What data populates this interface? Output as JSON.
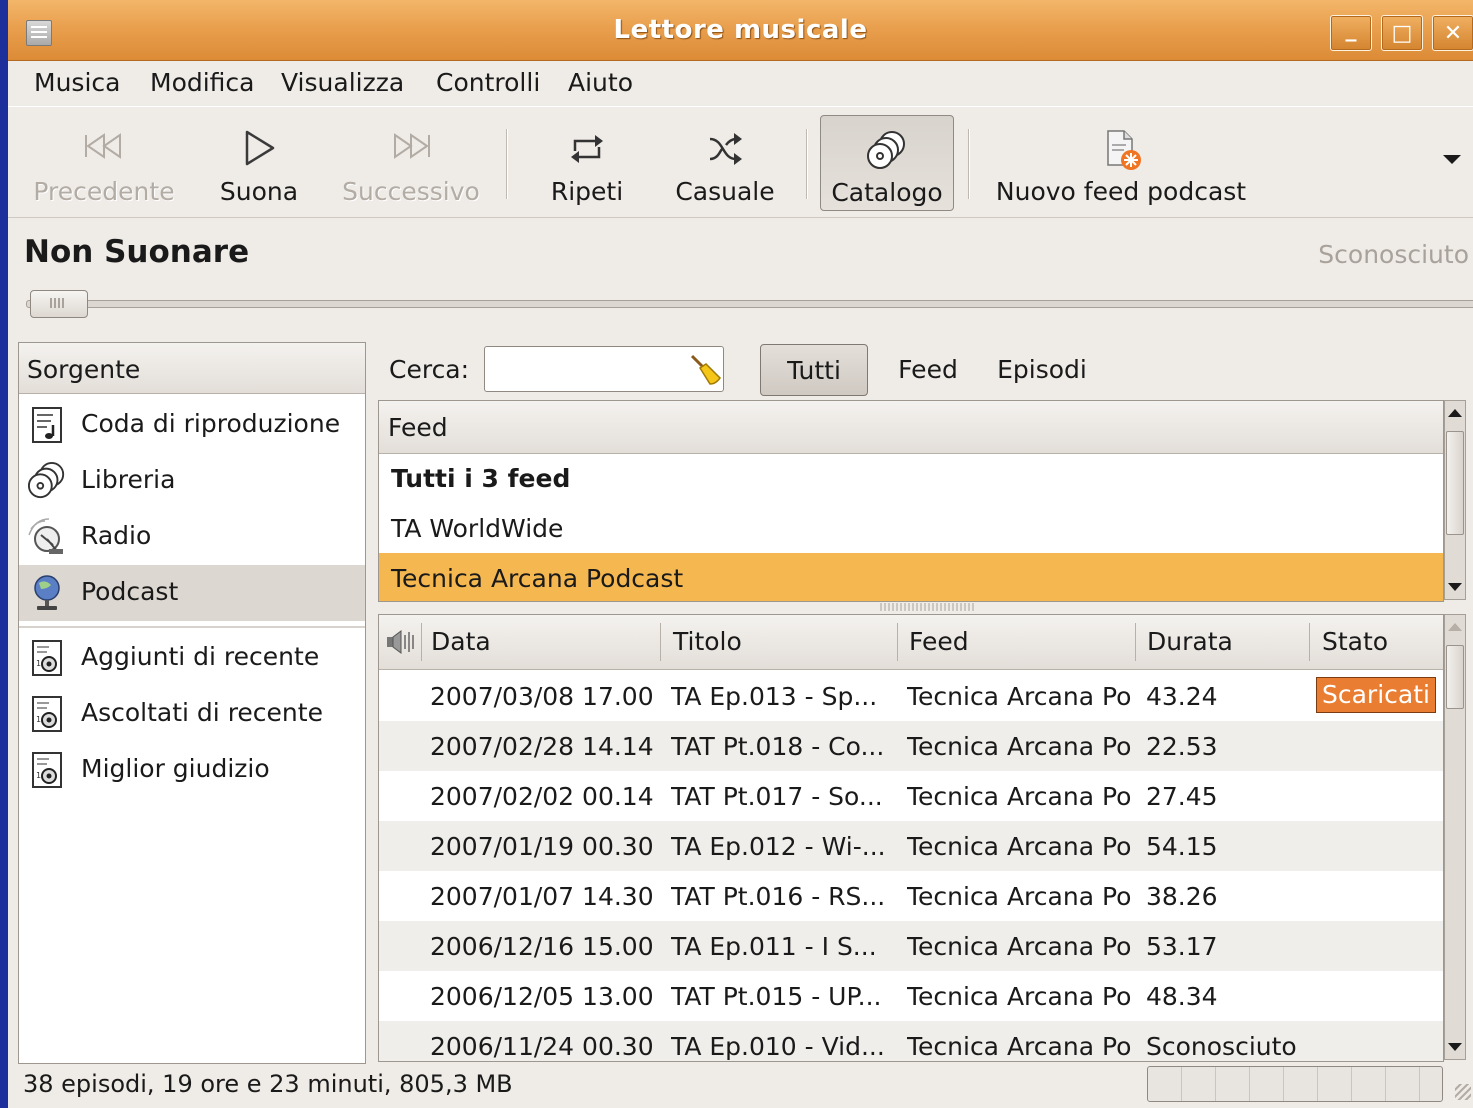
{
  "window": {
    "title": "Lettore musicale",
    "controls": {
      "minimize": "_",
      "maximize": "□",
      "close": "✕"
    }
  },
  "menubar": {
    "items": [
      "Musica",
      "Modifica",
      "Visualizza",
      "Controlli",
      "Aiuto"
    ]
  },
  "toolbar": {
    "previous": {
      "label": "Precedente",
      "icon": "previous-icon",
      "enabled": false
    },
    "play": {
      "label": "Suona",
      "icon": "play-icon",
      "enabled": true
    },
    "next": {
      "label": "Successivo",
      "icon": "next-icon",
      "enabled": false
    },
    "repeat": {
      "label": "Ripeti",
      "icon": "repeat-icon"
    },
    "shuffle": {
      "label": "Casuale",
      "icon": "shuffle-icon"
    },
    "browse": {
      "label": "Catalogo",
      "icon": "catalog-icon",
      "pressed": true
    },
    "new_podcast": {
      "label": "Nuovo feed podcast",
      "icon": "new-podcast-feed-icon"
    }
  },
  "now_playing": {
    "title": "Non Suonare",
    "artist": "Sconosciuto",
    "position_fraction": 0
  },
  "sidebar": {
    "header": "Sorgente",
    "items": [
      {
        "label": "Coda di riproduzione",
        "icon": "play-queue-icon",
        "selected": false
      },
      {
        "label": "Libreria",
        "icon": "library-icon",
        "selected": false
      },
      {
        "label": "Radio",
        "icon": "radio-icon",
        "selected": false
      },
      {
        "label": "Podcast",
        "icon": "podcast-icon",
        "selected": true
      },
      {
        "label": "Aggiunti di recente",
        "icon": "smart-playlist-icon",
        "selected": false
      },
      {
        "label": "Ascoltati di recente",
        "icon": "smart-playlist-icon",
        "selected": false
      },
      {
        "label": "Miglior giudizio",
        "icon": "smart-playlist-icon",
        "selected": false
      }
    ]
  },
  "search": {
    "label": "Cerca:",
    "value": "",
    "placeholder": "",
    "clear_icon": "broom-icon"
  },
  "filters": {
    "all": "Tutti",
    "feed": "Feed",
    "episodes": "Episodi",
    "active": "Tutti"
  },
  "feeds": {
    "header": "Feed",
    "rows": [
      {
        "label": "Tutti i 3 feed",
        "bold": true,
        "selected": false
      },
      {
        "label": "TA WorldWide",
        "bold": false,
        "selected": false
      },
      {
        "label": "Tecnica Arcana Podcast",
        "bold": false,
        "selected": true
      }
    ]
  },
  "episodes": {
    "columns": {
      "playing": "speaker-icon",
      "date": "Data",
      "title": "Titolo",
      "feed": "Feed",
      "duration": "Durata",
      "status": "Stato"
    },
    "rows": [
      {
        "date": "2007/03/08 17.00",
        "title": "TA Ep.013 - Sp...",
        "feed": "Tecnica Arcana Po",
        "duration": "43.24",
        "status": "Scaricati"
      },
      {
        "date": "2007/02/28 14.14",
        "title": "TAT Pt.018 - Co...",
        "feed": "Tecnica Arcana Po",
        "duration": "22.53",
        "status": ""
      },
      {
        "date": "2007/02/02 00.14",
        "title": "TAT Pt.017 - So...",
        "feed": "Tecnica Arcana Po",
        "duration": "27.45",
        "status": ""
      },
      {
        "date": "2007/01/19 00.30",
        "title": "TA Ep.012 - Wi-...",
        "feed": "Tecnica Arcana Po",
        "duration": "54.15",
        "status": ""
      },
      {
        "date": "2007/01/07 14.30",
        "title": "TAT Pt.016 - RS...",
        "feed": "Tecnica Arcana Po",
        "duration": "38.26",
        "status": ""
      },
      {
        "date": "2006/12/16 15.00",
        "title": "TA Ep.011 - I S...",
        "feed": "Tecnica Arcana Po",
        "duration": "53.17",
        "status": ""
      },
      {
        "date": "2006/12/05 13.00",
        "title": "TAT Pt.015 - UP...",
        "feed": "Tecnica Arcana Po",
        "duration": "48.34",
        "status": ""
      },
      {
        "date": "2006/11/24 00.30",
        "title": "TA Ep.010 - Vid...",
        "feed": "Tecnica Arcana Po",
        "duration": "Sconosciuto",
        "status": ""
      }
    ]
  },
  "statusbar": {
    "text": "38 episodi, 19 ore e 23 minuti, 805,3 MB",
    "progress_fraction": 0
  },
  "colors": {
    "titlebar": "#e9a04e",
    "selection": "#f5b851",
    "status_badge": "#e97d32",
    "desktop": "#1c2f9a"
  }
}
